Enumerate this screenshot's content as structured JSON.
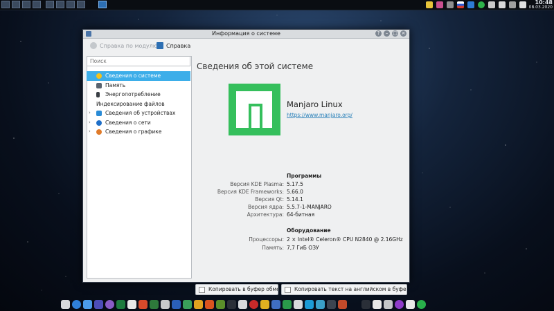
{
  "window": {
    "title": "Информация о системе",
    "toolbar": {
      "module_help": "Справка по модулю",
      "help": "Справка"
    },
    "search": {
      "placeholder": "Поиск"
    },
    "tree": [
      {
        "label": "Сведения о системе",
        "selected": true,
        "expandable": false,
        "depth": 1
      },
      {
        "label": "Память",
        "selected": false,
        "expandable": false,
        "depth": 1
      },
      {
        "label": "Энергопотребление",
        "selected": false,
        "expandable": false,
        "depth": 1
      },
      {
        "label": "Индексирование файлов",
        "selected": false,
        "expandable": false,
        "depth": 0
      },
      {
        "label": "Сведения об устройствах",
        "selected": false,
        "expandable": true,
        "depth": 1
      },
      {
        "label": "Сведения о сети",
        "selected": false,
        "expandable": true,
        "depth": 1
      },
      {
        "label": "Сведения о графике",
        "selected": false,
        "expandable": true,
        "depth": 1
      }
    ],
    "content": {
      "heading": "Сведения об этой системе",
      "distro_name": "Manjaro Linux",
      "distro_url": "https://www.manjaro.org/",
      "software_title": "Программы",
      "software": [
        {
          "key": "Версия KDE Plasma:",
          "value": "5.17.5"
        },
        {
          "key": "Версия KDE Frameworks:",
          "value": "5.66.0"
        },
        {
          "key": "Версия Qt:",
          "value": "5.14.1"
        },
        {
          "key": "Версия ядра:",
          "value": "5.5.7-1-MANJARO"
        },
        {
          "key": "Архитектура:",
          "value": "64-битная"
        }
      ],
      "hardware_title": "Оборудование",
      "hardware": [
        {
          "key": "Процессоры:",
          "value": "2 × Intel® Celeron® CPU N2840 @ 2.16GHz"
        },
        {
          "key": "Память:",
          "value": "7,7 ГиБ ОЗУ"
        }
      ],
      "copy_button": "Копировать в буфер обмена",
      "copy_en_button": "Копировать текст на английском в буфер обмена"
    }
  },
  "panel": {
    "time": "10:48",
    "date": "08.03.2020"
  },
  "colors": {
    "accent": "#3daee9",
    "logo_green": "#35bf5c",
    "link": "#2980b9"
  }
}
